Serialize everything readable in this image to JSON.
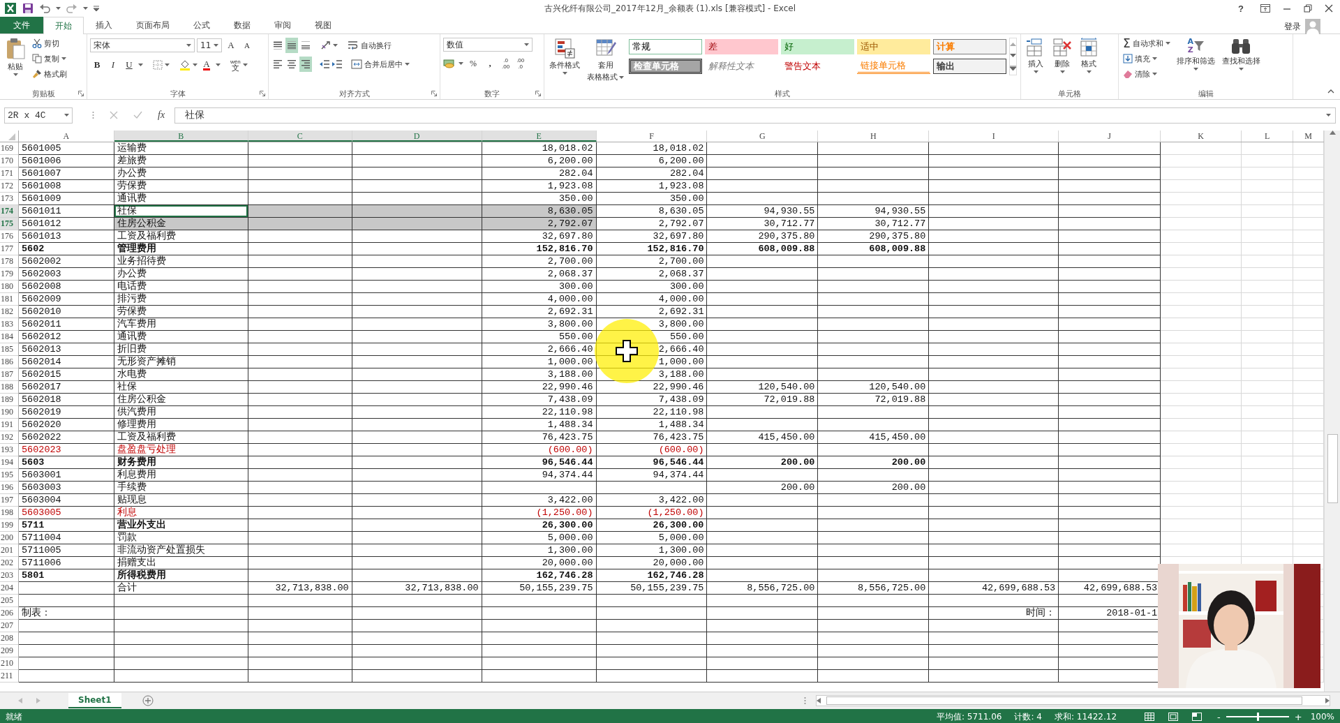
{
  "window": {
    "title": "古兴化纤有限公司_2017年12月_余额表 (1).xls  [兼容模式] - Excel",
    "help": "?",
    "sign_in": "登录"
  },
  "ribbon_tabs": [
    {
      "label": "文件",
      "kind": "file",
      "selected": false
    },
    {
      "label": "开始",
      "kind": "tab",
      "selected": true
    },
    {
      "label": "插入",
      "kind": "tab",
      "selected": false
    },
    {
      "label": "页面布局",
      "kind": "tab",
      "selected": false
    },
    {
      "label": "公式",
      "kind": "tab",
      "selected": false
    },
    {
      "label": "数据",
      "kind": "tab",
      "selected": false
    },
    {
      "label": "审阅",
      "kind": "tab",
      "selected": false
    },
    {
      "label": "视图",
      "kind": "tab",
      "selected": false
    }
  ],
  "ribbon": {
    "clipboard": {
      "label": "剪贴板",
      "paste": "粘贴",
      "cut": "剪切",
      "copy": "复制",
      "format_painter": "格式刷"
    },
    "font": {
      "label": "字体",
      "family": "宋体",
      "size": "11",
      "grow": "A",
      "shrink": "A",
      "bold": "B",
      "italic": "I",
      "underline": "U",
      "font_color": "A",
      "phonetic_top": "wén",
      "phonetic": "文"
    },
    "alignment": {
      "label": "对齐方式",
      "wrap_text": "自动换行",
      "merge_center": "合并后居中",
      "valign_buttons": [
        {
          "selected": false
        },
        {
          "selected": true
        },
        {
          "selected": false
        }
      ],
      "halign_buttons": [
        {
          "selected": false
        },
        {
          "selected": false
        },
        {
          "selected": true
        }
      ]
    },
    "number": {
      "label": "数字",
      "format": "数值",
      "percent": "%",
      "comma": ",",
      "inc_decimal": [
        ".0",
        ".00"
      ],
      "dec_decimal": [
        ".00",
        ".0"
      ]
    },
    "styles": {
      "label": "样式",
      "conditional": "条件格式",
      "format_table": [
        "套用",
        "表格格式"
      ],
      "gallery": [
        {
          "label": "常规",
          "kind": "normal"
        },
        {
          "label": "差",
          "kind": "bad"
        },
        {
          "label": "好",
          "kind": "good"
        },
        {
          "label": "适中",
          "kind": "neutral"
        },
        {
          "label": "计算",
          "kind": "calc"
        },
        {
          "label": "检查单元格",
          "kind": "check"
        },
        {
          "label": "解释性文本",
          "kind": "explanatory"
        },
        {
          "label": "警告文本",
          "kind": "warning"
        },
        {
          "label": "链接单元格",
          "kind": "linked"
        },
        {
          "label": "输出",
          "kind": "output"
        }
      ]
    },
    "cells": {
      "label": "单元格",
      "insert": "插入",
      "delete": "删除",
      "format": "格式"
    },
    "editing": {
      "label": "编辑",
      "sigma": "Σ",
      "autosum": "自动求和",
      "fill": "填充",
      "clear": "清除",
      "sort_a": "A",
      "sort_z": "Z",
      "sort_filter": "排序和筛选",
      "find_select": "查找和选择"
    }
  },
  "formula_bar": {
    "name_box": "2R x 4C",
    "fx": "fx",
    "formula": "社保"
  },
  "columns": [
    {
      "label": "A",
      "selected": false
    },
    {
      "label": "B",
      "selected": true
    },
    {
      "label": "C",
      "selected": true
    },
    {
      "label": "D",
      "selected": true
    },
    {
      "label": "E",
      "selected": true
    },
    {
      "label": "F",
      "selected": false
    },
    {
      "label": "G",
      "selected": false
    },
    {
      "label": "H",
      "selected": false
    },
    {
      "label": "I",
      "selected": false
    },
    {
      "label": "J",
      "selected": false
    },
    {
      "label": "K",
      "selected": false
    },
    {
      "label": "L",
      "selected": false
    },
    {
      "label": "M",
      "selected": false
    }
  ],
  "rows": [
    {
      "num": "169",
      "cells": {
        "a": "5601005",
        "b": "运输费",
        "e": "18,018.02",
        "f": "18,018.02"
      },
      "bold": false,
      "negative": false,
      "selected": false,
      "active": false
    },
    {
      "num": "170",
      "cells": {
        "a": "5601006",
        "b": "差旅费",
        "e": "6,200.00",
        "f": "6,200.00"
      },
      "bold": false,
      "negative": false,
      "selected": false,
      "active": false
    },
    {
      "num": "171",
      "cells": {
        "a": "5601007",
        "b": "办公费",
        "e": "282.04",
        "f": "282.04"
      },
      "bold": false,
      "negative": false,
      "selected": false,
      "active": false
    },
    {
      "num": "172",
      "cells": {
        "a": "5601008",
        "b": "劳保费",
        "e": "1,923.08",
        "f": "1,923.08"
      },
      "bold": false,
      "negative": false,
      "selected": false,
      "active": false
    },
    {
      "num": "173",
      "cells": {
        "a": "5601009",
        "b": "通讯费",
        "e": "350.00",
        "f": "350.00"
      },
      "bold": false,
      "negative": false,
      "selected": false,
      "active": false
    },
    {
      "num": "174",
      "cells": {
        "a": "5601011",
        "b": "社保",
        "e": "8,630.05",
        "f": "8,630.05",
        "g": "94,930.55",
        "h": "94,930.55"
      },
      "bold": false,
      "negative": false,
      "selected": true,
      "active": true
    },
    {
      "num": "175",
      "cells": {
        "a": "5601012",
        "b": "住房公积金",
        "e": "2,792.07",
        "f": "2,792.07",
        "g": "30,712.77",
        "h": "30,712.77"
      },
      "bold": false,
      "negative": false,
      "selected": true,
      "active": false
    },
    {
      "num": "176",
      "cells": {
        "a": "5601013",
        "b": "工资及福利费",
        "e": "32,697.80",
        "f": "32,697.80",
        "g": "290,375.80",
        "h": "290,375.80"
      },
      "bold": false,
      "negative": false,
      "selected": false,
      "active": false
    },
    {
      "num": "177",
      "cells": {
        "a": "5602",
        "b": "管理费用",
        "e": "152,816.70",
        "f": "152,816.70",
        "g": "608,009.88",
        "h": "608,009.88"
      },
      "bold": true,
      "negative": false,
      "selected": false,
      "active": false
    },
    {
      "num": "178",
      "cells": {
        "a": "5602002",
        "b": "业务招待费",
        "e": "2,700.00",
        "f": "2,700.00"
      },
      "bold": false,
      "negative": false,
      "selected": false,
      "active": false
    },
    {
      "num": "179",
      "cells": {
        "a": "5602003",
        "b": "办公费",
        "e": "2,068.37",
        "f": "2,068.37"
      },
      "bold": false,
      "negative": false,
      "selected": false,
      "active": false
    },
    {
      "num": "180",
      "cells": {
        "a": "5602008",
        "b": "电话费",
        "e": "300.00",
        "f": "300.00"
      },
      "bold": false,
      "negative": false,
      "selected": false,
      "active": false
    },
    {
      "num": "181",
      "cells": {
        "a": "5602009",
        "b": "排污费",
        "e": "4,000.00",
        "f": "4,000.00"
      },
      "bold": false,
      "negative": false,
      "selected": false,
      "active": false
    },
    {
      "num": "182",
      "cells": {
        "a": "5602010",
        "b": "劳保费",
        "e": "2,692.31",
        "f": "2,692.31"
      },
      "bold": false,
      "negative": false,
      "selected": false,
      "active": false
    },
    {
      "num": "183",
      "cells": {
        "a": "5602011",
        "b": "汽车费用",
        "e": "3,800.00",
        "f": "3,800.00"
      },
      "bold": false,
      "negative": false,
      "selected": false,
      "active": false
    },
    {
      "num": "184",
      "cells": {
        "a": "5602012",
        "b": "通讯费",
        "e": "550.00",
        "f": "550.00"
      },
      "bold": false,
      "negative": false,
      "selected": false,
      "active": false
    },
    {
      "num": "185",
      "cells": {
        "a": "5602013",
        "b": "折旧费",
        "e": "2,666.40",
        "f": "2,666.40"
      },
      "bold": false,
      "negative": false,
      "selected": false,
      "active": false
    },
    {
      "num": "186",
      "cells": {
        "a": "5602014",
        "b": "无形资产摊销",
        "e": "1,000.00",
        "f": "1,000.00"
      },
      "bold": false,
      "negative": false,
      "selected": false,
      "active": false
    },
    {
      "num": "187",
      "cells": {
        "a": "5602015",
        "b": "水电费",
        "e": "3,188.00",
        "f": "3,188.00"
      },
      "bold": false,
      "negative": false,
      "selected": false,
      "active": false
    },
    {
      "num": "188",
      "cells": {
        "a": "5602017",
        "b": "社保",
        "e": "22,990.46",
        "f": "22,990.46",
        "g": "120,540.00",
        "h": "120,540.00"
      },
      "bold": false,
      "negative": false,
      "selected": false,
      "active": false
    },
    {
      "num": "189",
      "cells": {
        "a": "5602018",
        "b": "住房公积金",
        "e": "7,438.09",
        "f": "7,438.09",
        "g": "72,019.88",
        "h": "72,019.88"
      },
      "bold": false,
      "negative": false,
      "selected": false,
      "active": false
    },
    {
      "num": "190",
      "cells": {
        "a": "5602019",
        "b": "供汽费用",
        "e": "22,110.98",
        "f": "22,110.98"
      },
      "bold": false,
      "negative": false,
      "selected": false,
      "active": false
    },
    {
      "num": "191",
      "cells": {
        "a": "5602020",
        "b": "修理费用",
        "e": "1,488.34",
        "f": "1,488.34"
      },
      "bold": false,
      "negative": false,
      "selected": false,
      "active": false
    },
    {
      "num": "192",
      "cells": {
        "a": "5602022",
        "b": "工资及福利费",
        "e": "76,423.75",
        "f": "76,423.75",
        "g": "415,450.00",
        "h": "415,450.00"
      },
      "bold": false,
      "negative": false,
      "selected": false,
      "active": false
    },
    {
      "num": "193",
      "cells": {
        "a": "5602023",
        "b": "盘盈盘亏处理",
        "e": "(600.00)",
        "f": "(600.00)"
      },
      "bold": false,
      "negative": true,
      "selected": false,
      "active": false
    },
    {
      "num": "194",
      "cells": {
        "a": "5603",
        "b": "财务费用",
        "e": "96,546.44",
        "f": "96,546.44",
        "g": "200.00",
        "h": "200.00"
      },
      "bold": true,
      "negative": false,
      "selected": false,
      "active": false
    },
    {
      "num": "195",
      "cells": {
        "a": "5603001",
        "b": "利息费用",
        "e": "94,374.44",
        "f": "94,374.44"
      },
      "bold": false,
      "negative": false,
      "selected": false,
      "active": false
    },
    {
      "num": "196",
      "cells": {
        "a": "5603003",
        "b": "手续费",
        "g": "200.00",
        "h": "200.00"
      },
      "bold": false,
      "negative": false,
      "selected": false,
      "active": false
    },
    {
      "num": "197",
      "cells": {
        "a": "5603004",
        "b": "贴现息",
        "e": "3,422.00",
        "f": "3,422.00"
      },
      "bold": false,
      "negative": false,
      "selected": false,
      "active": false
    },
    {
      "num": "198",
      "cells": {
        "a": "5603005",
        "b": "利息",
        "e": "(1,250.00)",
        "f": "(1,250.00)"
      },
      "bold": false,
      "negative": true,
      "selected": false,
      "active": false
    },
    {
      "num": "199",
      "cells": {
        "a": "5711",
        "b": "营业外支出",
        "e": "26,300.00",
        "f": "26,300.00"
      },
      "bold": true,
      "negative": false,
      "selected": false,
      "active": false
    },
    {
      "num": "200",
      "cells": {
        "a": "5711004",
        "b": "罚款",
        "e": "5,000.00",
        "f": "5,000.00"
      },
      "bold": false,
      "negative": false,
      "selected": false,
      "active": false
    },
    {
      "num": "201",
      "cells": {
        "a": "5711005",
        "b": "非流动资产处置损失",
        "e": "1,300.00",
        "f": "1,300.00"
      },
      "bold": false,
      "negative": false,
      "selected": false,
      "active": false
    },
    {
      "num": "202",
      "cells": {
        "a": "5711006",
        "b": "捐赠支出",
        "e": "20,000.00",
        "f": "20,000.00"
      },
      "bold": false,
      "negative": false,
      "selected": false,
      "active": false
    },
    {
      "num": "203",
      "cells": {
        "a": "5801",
        "b": "所得税费用",
        "e": "162,746.28",
        "f": "162,746.28"
      },
      "bold": true,
      "negative": false,
      "selected": false,
      "active": false
    },
    {
      "num": "204",
      "cells": {
        "b": "合计",
        "c": "32,713,838.00",
        "d": "32,713,838.00",
        "e": "50,155,239.75",
        "f": "50,155,239.75",
        "g": "8,556,725.00",
        "h": "8,556,725.00",
        "i": "42,699,688.53",
        "j": "42,699,688.53"
      },
      "bold": false,
      "negative": false,
      "selected": false,
      "active": false
    },
    {
      "num": "205",
      "cells": {},
      "selected": false,
      "active": false
    },
    {
      "num": "206",
      "cells": {
        "a": "制表：",
        "i": "时间：",
        "j": "2018-01-1"
      },
      "bold": false,
      "negative": false,
      "selected": false,
      "active": false
    },
    {
      "num": "207",
      "cells": {},
      "selected": false,
      "active": false
    },
    {
      "num": "208",
      "cells": {},
      "selected": false,
      "active": false
    },
    {
      "num": "209",
      "cells": {},
      "selected": false,
      "active": false
    },
    {
      "num": "210",
      "cells": {},
      "selected": false,
      "active": false
    },
    {
      "num": "211",
      "cells": {},
      "selected": false,
      "active": false
    }
  ],
  "sheet_tabs": [
    {
      "label": "Sheet1",
      "selected": true
    }
  ],
  "status_bar": {
    "ready": "就绪",
    "average": "平均值: 5711.06",
    "count": "计数: 4",
    "sum": "求和: 11422.12",
    "zoom_out": "-",
    "zoom_in": "+",
    "zoom": "100%",
    "zoom_slider": {
      "level": 0.5
    }
  }
}
